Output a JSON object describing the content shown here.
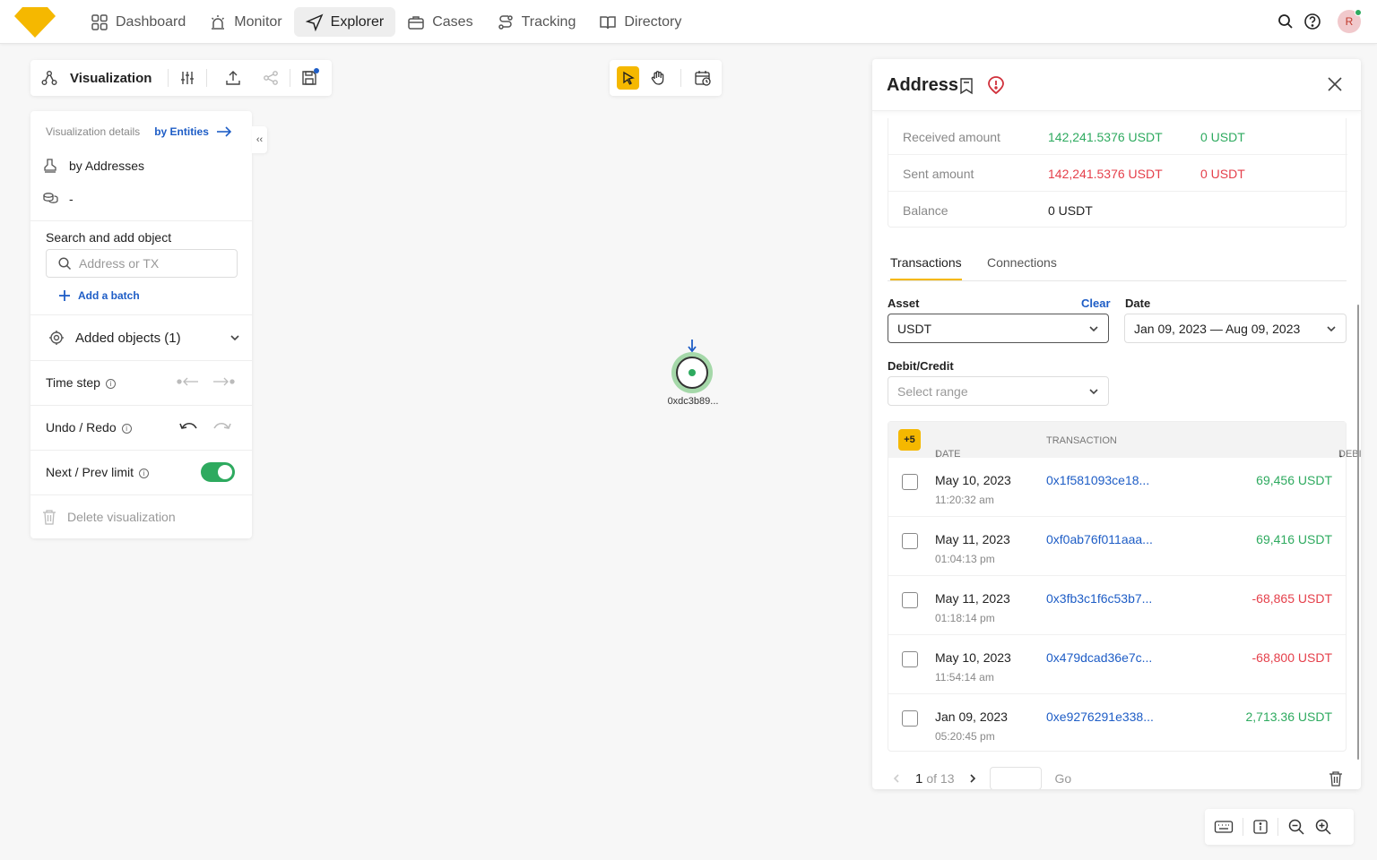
{
  "nav": {
    "items": [
      {
        "label": "Dashboard",
        "icon": "grid-icon"
      },
      {
        "label": "Monitor",
        "icon": "alarm-icon"
      },
      {
        "label": "Explorer",
        "icon": "navigation-icon"
      },
      {
        "label": "Cases",
        "icon": "briefcase-icon"
      },
      {
        "label": "Tracking",
        "icon": "route-icon"
      },
      {
        "label": "Directory",
        "icon": "book-icon"
      }
    ],
    "active": "Explorer",
    "avatar_initial": "R"
  },
  "viz_toolbar": {
    "title": "Visualization"
  },
  "left_panel": {
    "details_label": "Visualization details",
    "details_link": "by Entities",
    "by_addresses": "by Addresses",
    "coins_value": "-",
    "search_label": "Search and add object",
    "search_placeholder": "Address or TX",
    "add_batch": "Add a batch",
    "added_objects": "Added objects (1)",
    "time_step": "Time step",
    "undo_redo": "Undo / Redo",
    "next_prev_limit": "Next / Prev limit",
    "next_prev_enabled": true,
    "delete_viz": "Delete visualization"
  },
  "graph": {
    "node_label": "0xdc3b89..."
  },
  "address_panel": {
    "title": "Address",
    "amounts": [
      {
        "label": "Received amount",
        "value": "142,241.5376 USDT",
        "value2": "0 USDT"
      },
      {
        "label": "Sent amount",
        "value": "142,241.5376 USDT",
        "value2": "0 USDT"
      },
      {
        "label": "Balance",
        "value": "0 USDT",
        "value2": ""
      }
    ],
    "tabs": [
      "Transactions",
      "Connections"
    ],
    "asset_label": "Asset",
    "clear_label": "Clear",
    "asset_value": "USDT",
    "date_label": "Date",
    "date_value": "Jan 09, 2023 — Aug 09, 2023",
    "debit_label": "Debit/Credit",
    "debit_placeholder": "Select range",
    "table": {
      "badge": "+5",
      "col_date": "DATE",
      "col_tx": "TRANSACTION",
      "col_amount": "DEBIT/CREDIT",
      "rows": [
        {
          "date": "May 10, 2023",
          "time": "11:20:32 am",
          "hash": "0x1f581093ce18...",
          "amount": "69,456 USDT",
          "sign": "credit"
        },
        {
          "date": "May 11, 2023",
          "time": "01:04:13 pm",
          "hash": "0xf0ab76f011aaa...",
          "amount": "69,416 USDT",
          "sign": "credit"
        },
        {
          "date": "May 11, 2023",
          "time": "01:18:14 pm",
          "hash": "0x3fb3c1f6c53b7...",
          "amount": "-68,865 USDT",
          "sign": "debit"
        },
        {
          "date": "May 10, 2023",
          "time": "11:54:14 am",
          "hash": "0x479dcad36e7c...",
          "amount": "-68,800 USDT",
          "sign": "debit"
        },
        {
          "date": "Jan 09, 2023",
          "time": "05:20:45 pm",
          "hash": "0xe9276291e338...",
          "amount": "2,713.36 USDT",
          "sign": "credit"
        }
      ]
    },
    "pager": {
      "current": "1",
      "of_label": "of 13",
      "go_label": "Go"
    }
  },
  "colors": {
    "accent": "#f5b800",
    "link": "#1e5dc6",
    "credit": "#2eaa5f",
    "debit": "#e5404b"
  }
}
